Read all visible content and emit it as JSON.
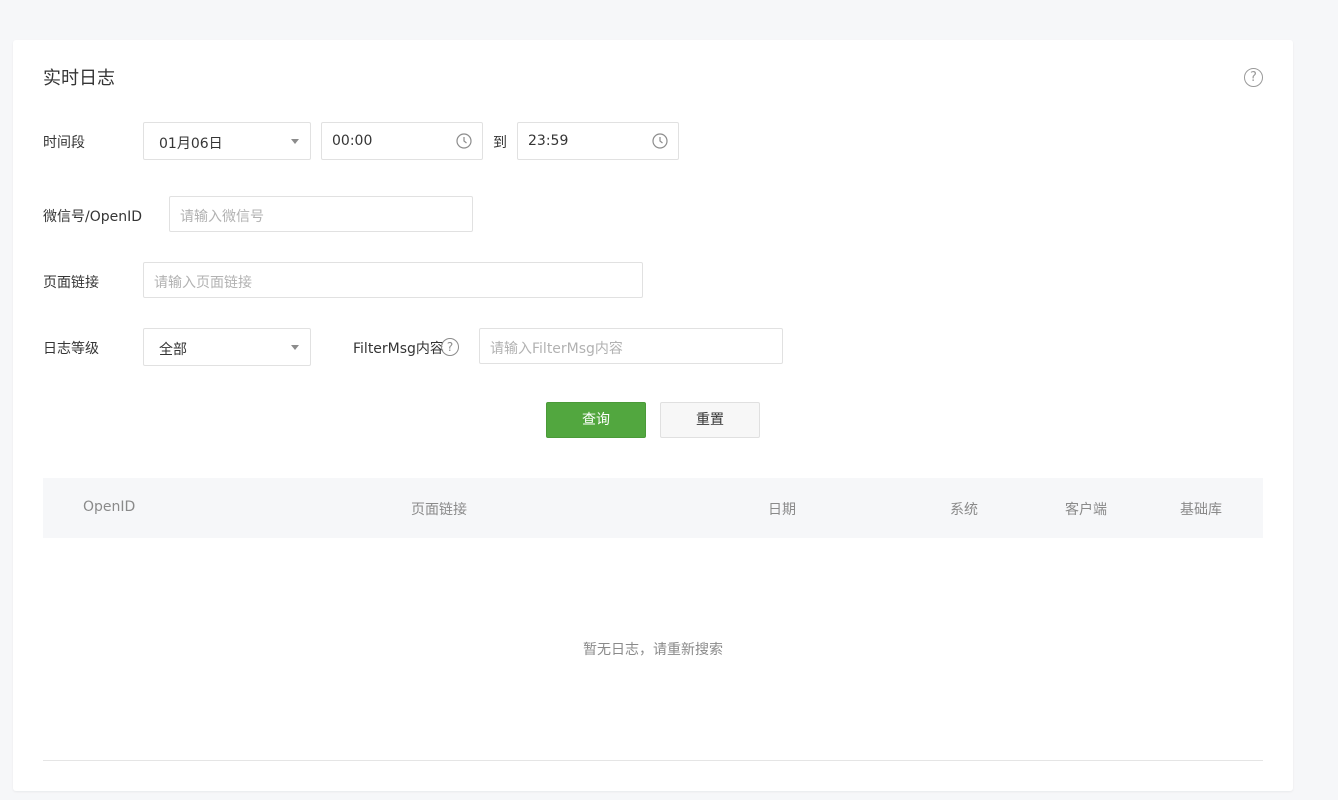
{
  "header": {
    "title": "实时日志",
    "help_glyph": "?"
  },
  "form": {
    "time_range": {
      "label": "时间段",
      "date_value": "01月06日",
      "start_time": "00:00",
      "to_label": "到",
      "end_time": "23:59"
    },
    "openid": {
      "label": "微信号/OpenID",
      "placeholder": "请输入微信号",
      "value": ""
    },
    "page_link": {
      "label": "页面链接",
      "placeholder": "请输入页面链接",
      "value": ""
    },
    "log_level": {
      "label": "日志等级",
      "selected": "全部"
    },
    "filter_msg": {
      "label": "FilterMsg内容",
      "help_glyph": "?",
      "placeholder": "请输入FilterMsg内容",
      "value": ""
    }
  },
  "actions": {
    "query_label": "查询",
    "reset_label": "重置"
  },
  "table": {
    "columns": [
      "OpenID",
      "页面链接",
      "日期",
      "系统",
      "客户端",
      "基础库"
    ],
    "rows": [],
    "empty_text": "暂无日志，请重新搜索"
  },
  "colors": {
    "primary": "#52a73f",
    "background": "#f6f7f9",
    "placeholder": "#b2b2b2"
  }
}
